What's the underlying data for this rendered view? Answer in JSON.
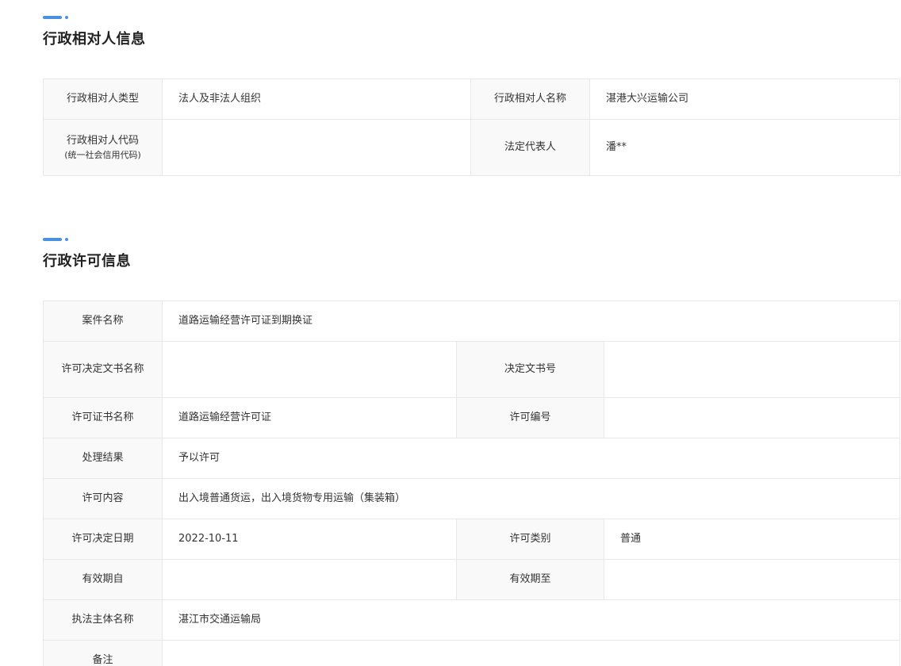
{
  "colors": {
    "accent": "#4a90e2",
    "label_bg": "#f9f9f9",
    "border": "#e8e8e8"
  },
  "party_section": {
    "title": "行政相对人信息",
    "rows": {
      "type_label": "行政相对人类型",
      "type_value": "法人及非法人组织",
      "name_label": "行政相对人名称",
      "name_value": "湛港大兴运输公司",
      "code_label": "行政相对人代码",
      "code_sublabel": "(统一社会信用代码)",
      "code_value": "",
      "rep_label": "法定代表人",
      "rep_value": "潘**"
    }
  },
  "license_section": {
    "title": "行政许可信息",
    "rows": {
      "case_label": "案件名称",
      "case_value": "道路运输经营许可证到期换证",
      "doc_name_label": "许可决定文书名称",
      "doc_name_value": "",
      "doc_no_label": "决定文书号",
      "doc_no_value": "",
      "cert_label": "许可证书名称",
      "cert_value": "道路运输经营许可证",
      "permit_no_label": "许可编号",
      "permit_no_value": "",
      "result_label": "处理结果",
      "result_value": "予以许可",
      "content_label": "许可内容",
      "content_value": "出入境普通货运，出入境货物专用运输（集装箱）",
      "date_label": "许可决定日期",
      "date_value": "2022-10-11",
      "category_label": "许可类别",
      "category_value": "普通",
      "valid_from_label": "有效期自",
      "valid_from_value": "",
      "valid_to_label": "有效期至",
      "valid_to_value": "",
      "authority_label": "执法主体名称",
      "authority_value": "湛江市交通运输局",
      "remark_label": "备注",
      "remark_value": ""
    }
  }
}
